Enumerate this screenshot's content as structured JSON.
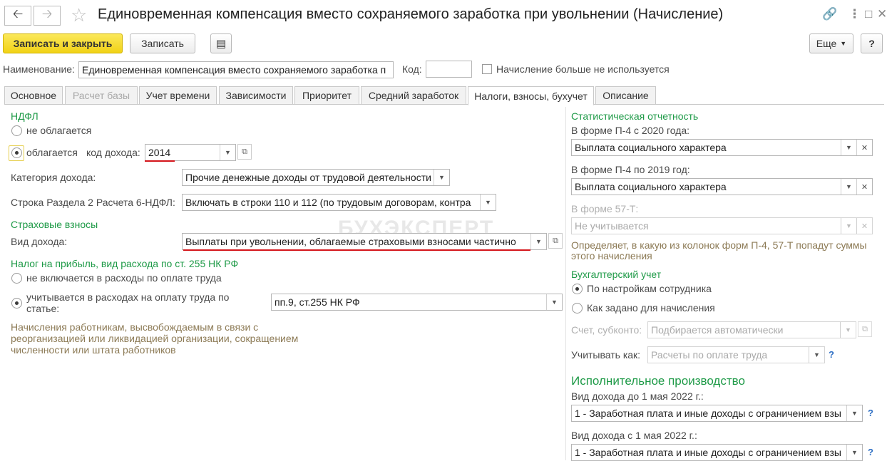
{
  "window": {
    "title": "Единовременная компенсация вместо сохраняемого заработка при увольнении (Начисление)"
  },
  "toolbar": {
    "save_close_label": "Записать и закрыть",
    "save_label": "Записать",
    "more_label": "Еще",
    "help_label": "?"
  },
  "header": {
    "name_label": "Наименование:",
    "name_value": "Единовременная компенсация вместо сохраняемого заработка п",
    "code_label": "Код:",
    "code_value": "",
    "unused_label": "Начисление больше не используется"
  },
  "tabs": [
    {
      "label": "Основное",
      "state": "normal"
    },
    {
      "label": "Расчет базы",
      "state": "disabled"
    },
    {
      "label": "Учет времени",
      "state": "normal"
    },
    {
      "label": "Зависимости",
      "state": "normal"
    },
    {
      "label": "Приоритет",
      "state": "normal"
    },
    {
      "label": "Средний заработок",
      "state": "normal"
    },
    {
      "label": "Налоги, взносы, бухучет",
      "state": "active"
    },
    {
      "label": "Описание",
      "state": "normal"
    }
  ],
  "left": {
    "ndfl_title": "НДФЛ",
    "not_taxed_label": "не облагается",
    "taxed_label": "облагается",
    "income_code_label": "код дохода:",
    "income_code_value": "2014",
    "income_category_label": "Категория дохода:",
    "income_category_value": "Прочие денежные доходы от трудовой деятельности",
    "section2_label": "Строка Раздела 2 Расчета 6-НДФЛ:",
    "section2_value": "Включать в строки 110 и 112 (по трудовым договорам, контра",
    "insurance_title": "Страховые взносы",
    "income_type_label": "Вид дохода:",
    "income_type_value": "Выплаты при увольнении, облагаемые страховыми взносами частично",
    "profit_tax_title": "Налог на прибыль, вид расхода по ст. 255 НК РФ",
    "not_included_label": "не включается в расходы по оплате труда",
    "included_label_1": "учитывается в расходах на оплату труда по",
    "included_label_2": "статье:",
    "article_value": "пп.9, ст.255 НК РФ",
    "note_1": "Начисления работникам, высвобождаемым в связи с",
    "note_2": "реорганизацией или ликвидацией организации, сокращением",
    "note_3": "численности или штата работников"
  },
  "right": {
    "stat_title": "Статистическая отчетность",
    "p4_2020_label": "В форме П-4 с 2020 года:",
    "p4_2020_value": "Выплата социального характера",
    "p4_2019_label": "В форме П-4 по 2019 год:",
    "p4_2019_value": "Выплата социального характера",
    "f57_label": "В форме 57-Т:",
    "f57_value": "Не учитывается",
    "stat_note_1": "Определяет, в какую из колонок форм П-4, 57-Т попадут суммы",
    "stat_note_2": "этого начисления",
    "accounting_title": "Бухгалтерский учет",
    "by_employee_label": "По настройкам сотрудника",
    "as_accrual_label": "Как задано для начисления",
    "account_label": "Счет, субконто:",
    "account_value": "Подбирается автоматически",
    "count_as_label": "Учитывать как:",
    "count_as_value": "Расчеты по оплате труда",
    "enforcement_title": "Исполнительное производство",
    "before_label": "Вид дохода до 1 мая 2022 г.:",
    "before_value": "1 - Заработная плата и иные доходы с ограничением взы",
    "after_label": "Вид дохода с 1 мая 2022 г.:",
    "after_value": "1 - Заработная плата и иные доходы с ограничением взы"
  },
  "watermark": "БУХЭКСПЕРТ"
}
